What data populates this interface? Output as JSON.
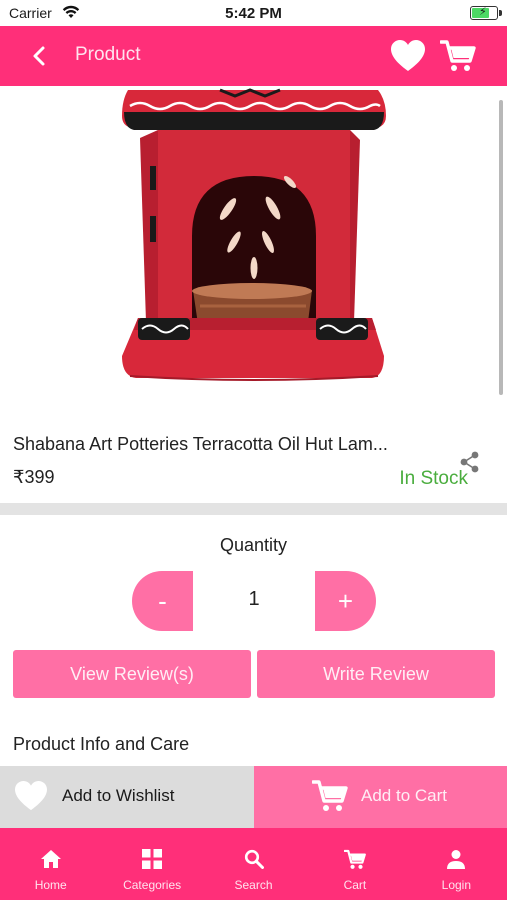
{
  "status_bar": {
    "carrier": "Carrier",
    "time": "5:42 PM"
  },
  "header": {
    "title": "Product",
    "back_icon": "chevron-left-icon",
    "wishlist_icon": "heart-icon",
    "cart_icon": "cart-icon"
  },
  "product": {
    "name": "Shabana Art Potteries Terracotta Oil Hut Lam...",
    "price": "₹399",
    "stock_status": "In Stock",
    "image_subject": "red terracotta oil burner hut"
  },
  "quantity": {
    "label": "Quantity",
    "minus_label": "-",
    "value": "1",
    "plus_label": "+"
  },
  "reviews": {
    "view_label": "View Review(s)",
    "write_label": "Write Review"
  },
  "info": {
    "title": "Product Info and Care"
  },
  "actions": {
    "wishlist_label": "Add to Wishlist",
    "cart_label": "Add to Cart"
  },
  "bottom_nav": {
    "items": [
      {
        "label": "Home",
        "icon": "home-icon"
      },
      {
        "label": "Categories",
        "icon": "grid-icon"
      },
      {
        "label": "Search",
        "icon": "search-icon"
      },
      {
        "label": "Cart",
        "icon": "cart-icon"
      },
      {
        "label": "Login",
        "icon": "user-icon"
      }
    ]
  },
  "colors": {
    "brand": "#ff2f79",
    "accent_light": "#ff6fa5",
    "in_stock": "#4aad3e",
    "divider": "#e3e3e3"
  }
}
